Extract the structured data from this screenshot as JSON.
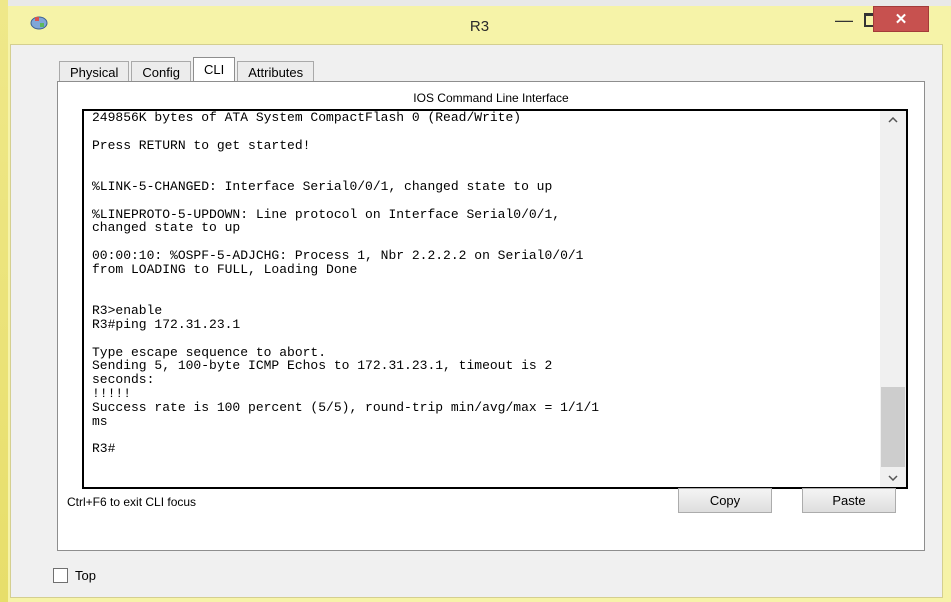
{
  "window": {
    "title": "R3",
    "minimize": "—",
    "close": "✕"
  },
  "tabs": [
    {
      "label": "Physical"
    },
    {
      "label": "Config"
    },
    {
      "label": "CLI"
    },
    {
      "label": "Attributes"
    }
  ],
  "cli": {
    "panel_label": "IOS Command Line Interface",
    "output": "249856K bytes of ATA System CompactFlash 0 (Read/Write)\n\nPress RETURN to get started!\n\n\n%LINK-5-CHANGED: Interface Serial0/0/1, changed state to up\n\n%LINEPROTO-5-UPDOWN: Line protocol on Interface Serial0/0/1,\nchanged state to up\n\n00:00:10: %OSPF-5-ADJCHG: Process 1, Nbr 2.2.2.2 on Serial0/0/1\nfrom LOADING to FULL, Loading Done\n\n\nR3>enable\nR3#ping 172.31.23.1\n\nType escape sequence to abort.\nSending 5, 100-byte ICMP Echos to 172.31.23.1, timeout is 2\nseconds:\n!!!!!\nSuccess rate is 100 percent (5/5), round-trip min/avg/max = 1/1/1\nms\n\nR3#",
    "focus_hint": "Ctrl+F6 to exit CLI focus",
    "copy_label": "Copy",
    "paste_label": "Paste"
  },
  "footer": {
    "top_label": "Top",
    "top_checked": false
  }
}
